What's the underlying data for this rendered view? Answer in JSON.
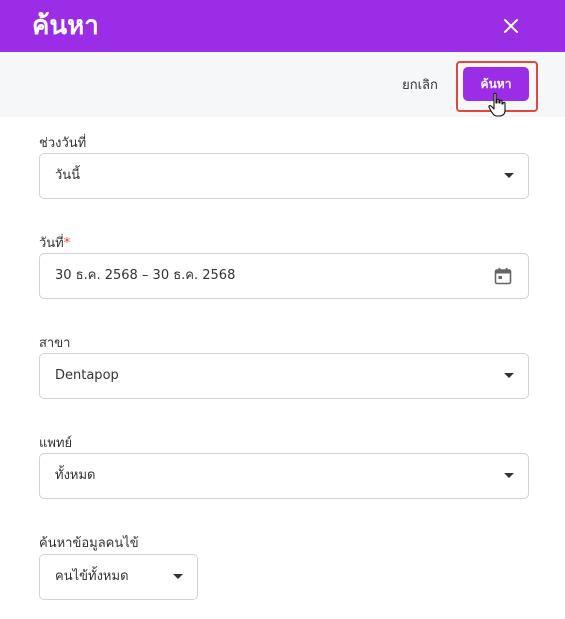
{
  "header": {
    "title": "ค้นหา",
    "close_icon": "close-icon"
  },
  "toolbar": {
    "cancel_label": "ยกเลิก",
    "search_label": "ค้นหา"
  },
  "form": {
    "date_range": {
      "label": "ช่วงวันที่",
      "value": "วันนี้"
    },
    "date": {
      "label": "วันที่",
      "required_mark": "*",
      "value": "30 ธ.ค. 2568 – 30 ธ.ค. 2568",
      "icon": "calendar-icon"
    },
    "branch": {
      "label": "สาขา",
      "value": "Dentapop"
    },
    "doctor": {
      "label": "แพทย์",
      "value": "ทั้งหมด"
    },
    "patient": {
      "label": "ค้นหาข้อมูลคนไข้",
      "value": "คนไข้ทั้งหมด"
    }
  },
  "colors": {
    "accent": "#9b2de6",
    "highlight": "#e0483f",
    "required": "#e53935"
  }
}
